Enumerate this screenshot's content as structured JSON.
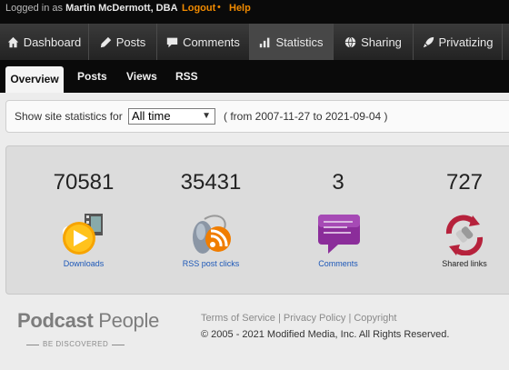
{
  "topbar": {
    "logged_in_prefix": "Logged in as",
    "user_name": "Martin McDermott, DBA",
    "logout": "Logout",
    "separator": "•",
    "help": "Help"
  },
  "main_nav": [
    {
      "label": "Dashboard",
      "icon": "home-icon"
    },
    {
      "label": "Posts",
      "icon": "pencil-icon"
    },
    {
      "label": "Comments",
      "icon": "speech-bubble-icon"
    },
    {
      "label": "Statistics",
      "icon": "bar-chart-icon",
      "active": true
    },
    {
      "label": "Sharing",
      "icon": "globe-icon"
    },
    {
      "label": "Privatizing",
      "icon": "rocket-icon"
    }
  ],
  "sub_nav": [
    {
      "label": "Overview",
      "active": true
    },
    {
      "label": "Posts"
    },
    {
      "label": "Views"
    },
    {
      "label": "RSS"
    }
  ],
  "filter": {
    "label": "Show site statistics for",
    "selected": "All time",
    "range": "( from 2007-11-27 to 2021-09-04 )"
  },
  "stats": [
    {
      "value": "70581",
      "caption": "Downloads",
      "icon": "play-film-icon",
      "link": true
    },
    {
      "value": "35431",
      "caption": "RSS post clicks",
      "icon": "mouse-rss-icon",
      "link": true
    },
    {
      "value": "3",
      "caption": "Comments",
      "icon": "comment-bubble-icon",
      "link": true
    },
    {
      "value": "727",
      "caption": "Shared links",
      "icon": "share-link-icon",
      "link": false
    }
  ],
  "footer": {
    "logo_bold": "Podcast",
    "logo_light": "People",
    "tagline": "BE DISCOVERED",
    "links": [
      "Terms of Service",
      "Privacy Policy",
      "Copyright"
    ],
    "link_separator": "|",
    "copyright": "© 2005 - 2021 Modified Media, Inc. All Rights Reserved."
  }
}
